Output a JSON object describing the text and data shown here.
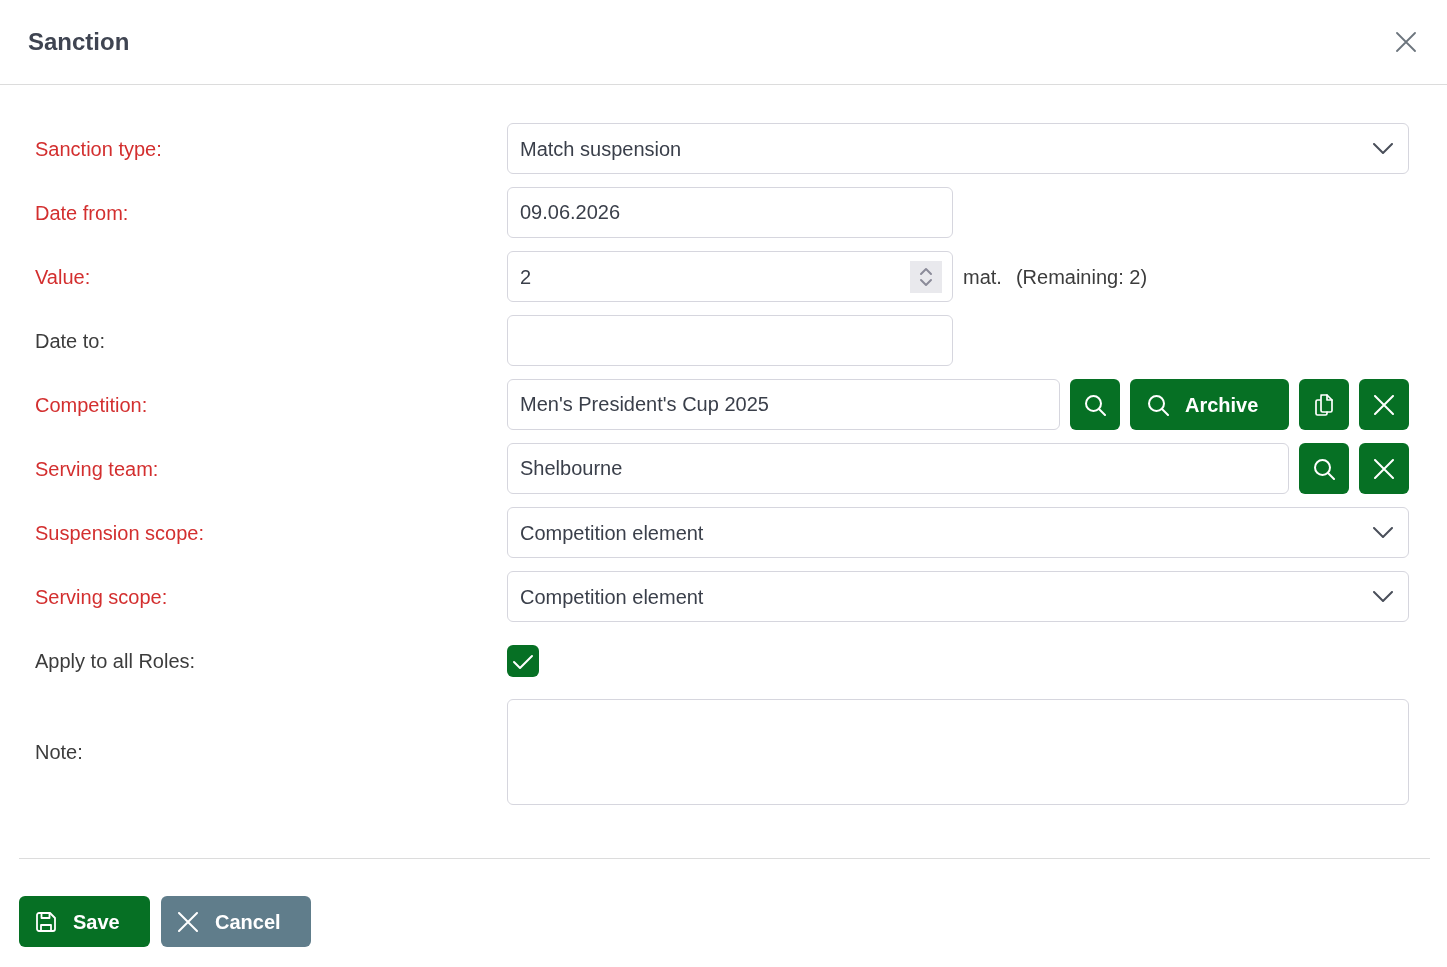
{
  "dialog": {
    "title": "Sanction"
  },
  "fields": [
    {
      "kind": "select",
      "label": "Sanction type:",
      "required": true,
      "value": "Match suspension"
    },
    {
      "kind": "date",
      "label": "Date from:",
      "required": true,
      "value": "09.06.2026"
    },
    {
      "kind": "number",
      "label": "Value:",
      "required": true,
      "value": "2",
      "unit": "mat.",
      "remaining": "(Remaining: 2)"
    },
    {
      "kind": "date",
      "label": "Date to:",
      "required": false
    },
    {
      "kind": "lookup",
      "label": "Competition:",
      "required": true,
      "value": "Men's President's Cup 2025",
      "buttons": [
        {
          "kind": "search"
        },
        {
          "kind": "archive",
          "label": "Archive"
        },
        {
          "kind": "copy"
        },
        {
          "kind": "clear"
        }
      ]
    },
    {
      "kind": "lookup",
      "label": "Serving team:",
      "required": true,
      "value": "Shelbourne",
      "buttons": [
        {
          "kind": "search"
        },
        {
          "kind": "clear"
        }
      ]
    },
    {
      "kind": "select",
      "label": "Suspension scope:",
      "required": true,
      "value": "Competition element"
    },
    {
      "kind": "select",
      "label": "Serving scope:",
      "required": true,
      "value": "Competition element"
    },
    {
      "kind": "checkbox",
      "label": "Apply to all Roles:",
      "required": false,
      "checked": true
    },
    {
      "kind": "textarea",
      "label": "Note:",
      "required": false
    }
  ],
  "footer_buttons": [
    {
      "kind": "save",
      "label": "Save"
    },
    {
      "kind": "cancel",
      "label": "Cancel"
    }
  ]
}
